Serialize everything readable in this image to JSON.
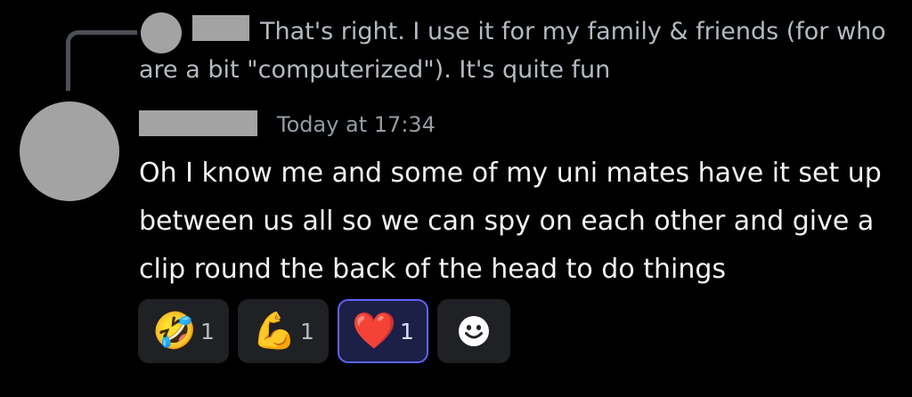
{
  "reply_preview": {
    "text": "That's right. I use it for my family & friends (for who are a bit \"computerized\"). It's quite fun"
  },
  "message": {
    "timestamp": "Today at 17:34",
    "body": "Oh I know me and some of my uni mates have it set up between us all so we can spy on each other and give a clip round the back of the head to do things"
  },
  "reactions": [
    {
      "emoji": "🤣",
      "count": "1",
      "selected": false
    },
    {
      "emoji": "💪",
      "count": "1",
      "selected": false
    },
    {
      "emoji": "❤️",
      "count": "1",
      "selected": true
    }
  ],
  "add_reaction": {
    "icon": "add-reaction-smiley-icon"
  },
  "colors": {
    "background": "#000000",
    "text_primary": "#f2f3f5",
    "text_muted": "#b5bac1",
    "timestamp": "#949ba4",
    "reaction_bg": "#202124",
    "reaction_selected_bg": "#1c1f46",
    "reaction_selected_border": "#5d65f5",
    "redaction_gray": "#a3a3a3"
  }
}
